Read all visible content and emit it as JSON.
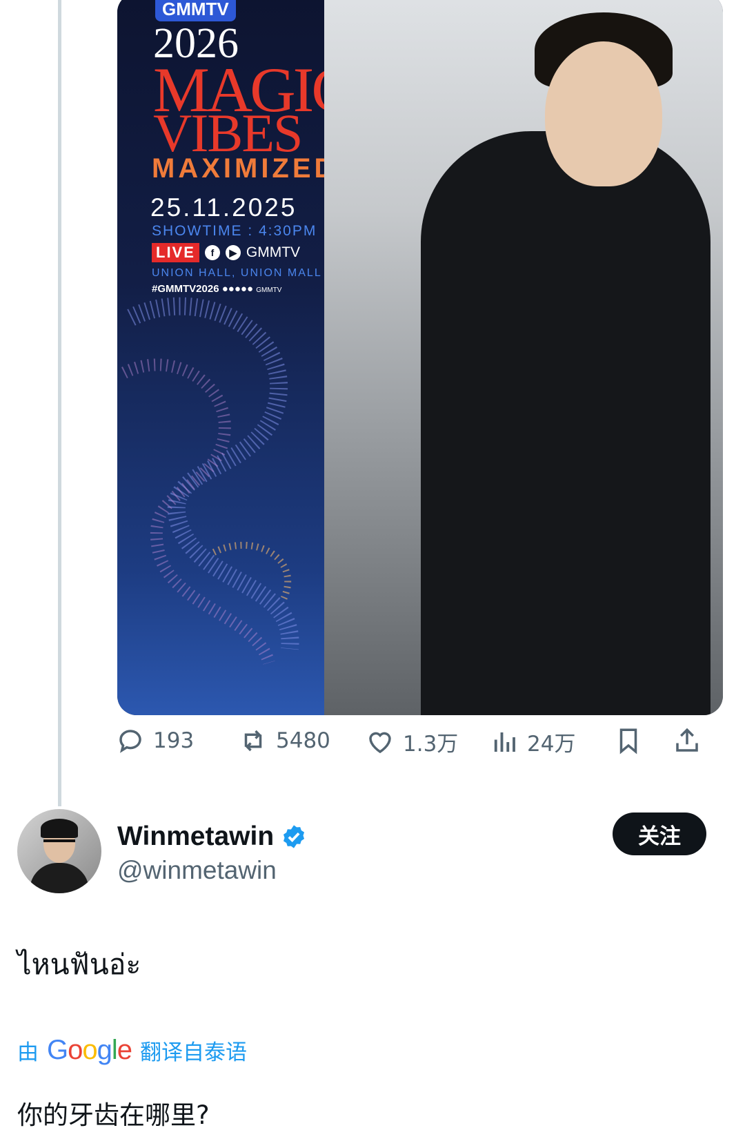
{
  "poster": {
    "logo": "GMMTV",
    "year": "2026",
    "title_line1": "MAGIC",
    "title_line2": "VIBES",
    "title_line3": "MAXIMIZED",
    "date": "25.11.2025",
    "showtime": "SHOWTIME : 4:30PM",
    "live": "LIVE",
    "channel": "GMMTV",
    "venue": "UNION HALL, UNION MALL",
    "hashtag": "#GMMTV2026",
    "hashtag_handle": "GMMTV"
  },
  "actions": {
    "replies": "193",
    "reposts": "5480",
    "likes": "1.3万",
    "views": "24万"
  },
  "reply": {
    "display_name": "Winmetawin",
    "handle": "@winmetawin",
    "follow_label": "关注",
    "text": "ไหนฟันอ่ะ",
    "translate_prefix": "由",
    "translate_brand": "Google",
    "translate_suffix": "翻译自泰语",
    "translated_text": "你的牙齿在哪里?"
  },
  "colors": {
    "accent": "#1d9bf0",
    "muted": "#536471",
    "live": "#e52a2a",
    "poster_red": "#e8392a"
  }
}
